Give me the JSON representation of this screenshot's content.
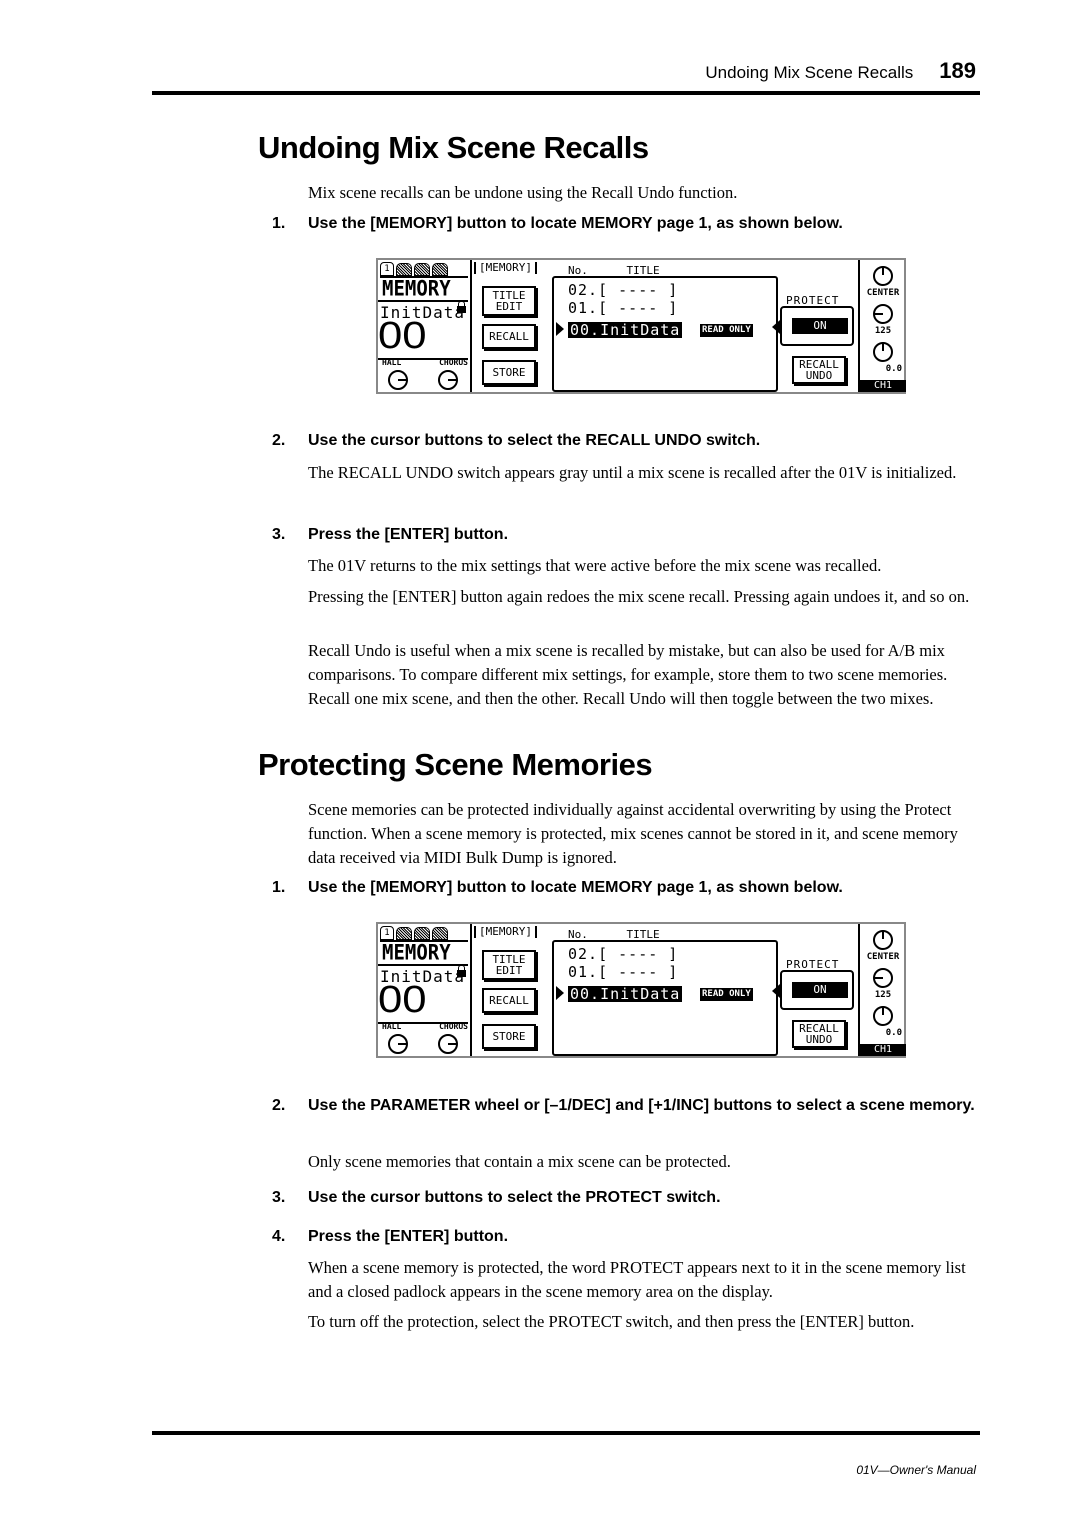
{
  "header": {
    "running_title": "Undoing Mix Scene Recalls",
    "page_number": "189"
  },
  "footer": {
    "manual_title": "01V—Owner's Manual"
  },
  "section1": {
    "heading": "Undoing Mix Scene Recalls",
    "intro": "Mix scene recalls can be undone using the Recall Undo function.",
    "step1": {
      "num": "1.",
      "text": "Use the [MEMORY] button to locate MEMORY page 1, as shown below."
    },
    "step2": {
      "num": "2.",
      "text": "Use the cursor buttons to select the RECALL UNDO switch."
    },
    "step2_body": "The RECALL UNDO switch appears gray until a mix scene is recalled after the 01V is initialized.",
    "step3": {
      "num": "3.",
      "text": "Press the [ENTER] button."
    },
    "step3_body1": "The 01V returns to the mix settings that were active before the mix scene was recalled.",
    "step3_body2": "Pressing the [ENTER] button again redoes the mix scene recall. Pressing again undoes it, and so on.",
    "step3_body3": "Recall Undo is useful when a mix scene is recalled by mistake, but can also be used for A/B mix comparisons. To compare different mix settings, for example, store them to two scene memories. Recall one mix scene, and then the other. Recall Undo will then toggle between the two mixes."
  },
  "section2": {
    "heading": "Protecting Scene Memories",
    "intro": "Scene memories can be protected individually against accidental overwriting by using the Protect function. When a scene memory is protected, mix scenes cannot be stored in it, and scene memory data received via MIDI Bulk Dump is ignored.",
    "step1": {
      "num": "1.",
      "text": "Use the [MEMORY] button to locate MEMORY page 1, as shown below."
    },
    "step2": {
      "num": "2.",
      "text": "Use the PARAMETER wheel or [–1/DEC] and [+1/INC] buttons to select a scene memory."
    },
    "step2_body": "Only scene memories that contain a mix scene can be protected.",
    "step3": {
      "num": "3.",
      "text": "Use the cursor buttons to select the PROTECT switch."
    },
    "step4": {
      "num": "4.",
      "text": "Press the [ENTER] button."
    },
    "step4_body1": "When a scene memory is protected, the word PROTECT appears next to it in the scene memory list and a closed padlock appears in the scene memory area on the display.",
    "step4_body2": "To turn off the protection, select the PROTECT switch, and then press the [ENTER] button."
  },
  "lcd": {
    "tab_number": "1",
    "mode_title": "MEMORY",
    "scene_name": "InitData",
    "scene_number": "00",
    "fx1_label": "HALL",
    "fx2_label": "CHORUS",
    "page_label": "[MEMORY]",
    "title_edit_line1": "TITLE",
    "title_edit_line2": "EDIT",
    "recall_button": "RECALL",
    "store_button": "STORE",
    "col_no": "No.",
    "col_title": "TITLE",
    "rows": [
      "02.[ ---- ]",
      "01.[ ---- ]",
      "00.InitData"
    ],
    "read_only": "READ ONLY",
    "protect_label": "PROTECT",
    "protect_value": "ON",
    "recall_undo_line1": "RECALL",
    "recall_undo_line2": "UNDO",
    "pan_label": "CENTER",
    "level_value": "125",
    "gain_value": "0.0",
    "channel": "CH1"
  }
}
